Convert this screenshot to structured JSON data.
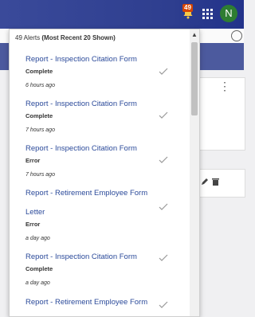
{
  "topbar": {
    "notification_count": "49",
    "avatar_initial": "N"
  },
  "alerts": {
    "header_count": "49 Alerts",
    "header_note": "(Most Recent 20 Shown)",
    "items": [
      {
        "title": "Report - Inspection Citation Form",
        "status": "Complete",
        "time": "6 hours ago"
      },
      {
        "title": "Report - Inspection Citation Form",
        "status": "Complete",
        "time": "7 hours ago"
      },
      {
        "title": "Report - Inspection Citation Form",
        "status": "Error",
        "time": "7 hours ago"
      },
      {
        "title_line1": "Report - Retirement Employee Form",
        "title_line2": "Letter",
        "status": "Error",
        "time": "a day ago"
      },
      {
        "title": "Report - Inspection Citation Form",
        "status": "Complete",
        "time": "a day ago"
      },
      {
        "title": "Report - Retirement Employee Form"
      }
    ]
  }
}
